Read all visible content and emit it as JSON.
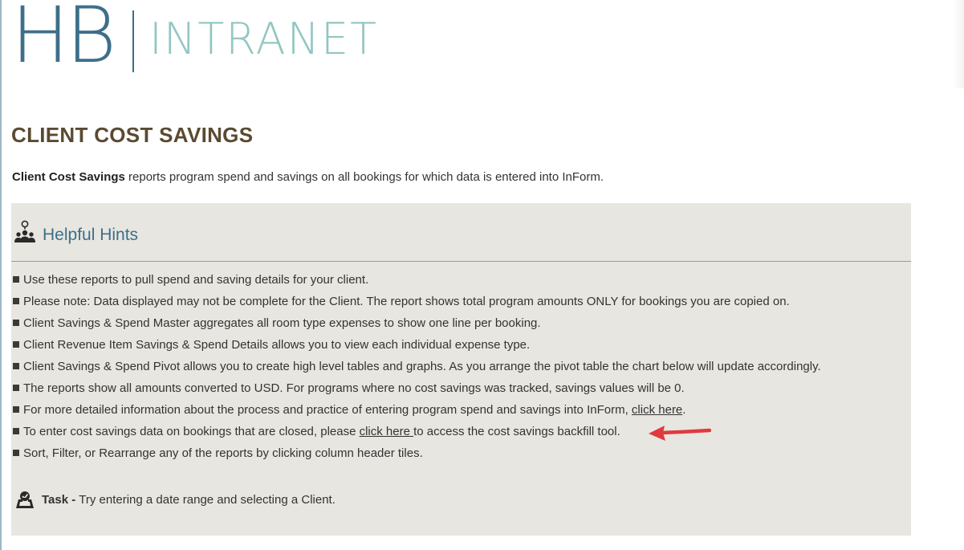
{
  "header": {
    "logo_mark": "HB",
    "logo_text": "INTRANET"
  },
  "page": {
    "title": "CLIENT COST SAVINGS",
    "intro_bold": "Client Cost Savings",
    "intro_rest": " reports program spend and savings on all bookings for which data is entered into InForm."
  },
  "hints": {
    "title": "Helpful Hints",
    "icon": "team-location-icon",
    "items": [
      "Use these reports to pull spend and saving details for your client.",
      "Please note: Data displayed may not be complete for the Client. The report shows total program amounts ONLY for bookings you are copied on.",
      "Client Savings & Spend Master aggregates all room type expenses to show one line per booking.",
      "Client Revenue Item Savings & Spend Details allows you to view each individual expense type.",
      "Client Savings & Spend Pivot allows you to create high level tables and graphs. As you arrange the pivot table the chart below will update accordingly.",
      "The reports show all amounts converted to USD. For programs where no cost savings was tracked, savings values will be 0."
    ],
    "info_item": {
      "before": "For more detailed information about the process and practice of entering program spend and savings into InForm, ",
      "link": "click here",
      "after": "."
    },
    "backfill_item": {
      "before": "To enter cost savings data on bookings that are closed, please ",
      "link": "click here ",
      "after": "to access the cost savings backfill tool."
    },
    "last_item": "Sort, Filter, or Rearrange any of the reports by clicking column header tiles."
  },
  "task": {
    "icon": "map-check-icon",
    "label": "Task -",
    "text": " Try entering a date range and selecting a Client."
  },
  "colors": {
    "brand_blue": "#3d6f8a",
    "brand_teal": "#92c6c2",
    "title_brown": "#5a4a32",
    "panel_bg": "#e8e6e0",
    "arrow_red": "#e03a3e"
  }
}
